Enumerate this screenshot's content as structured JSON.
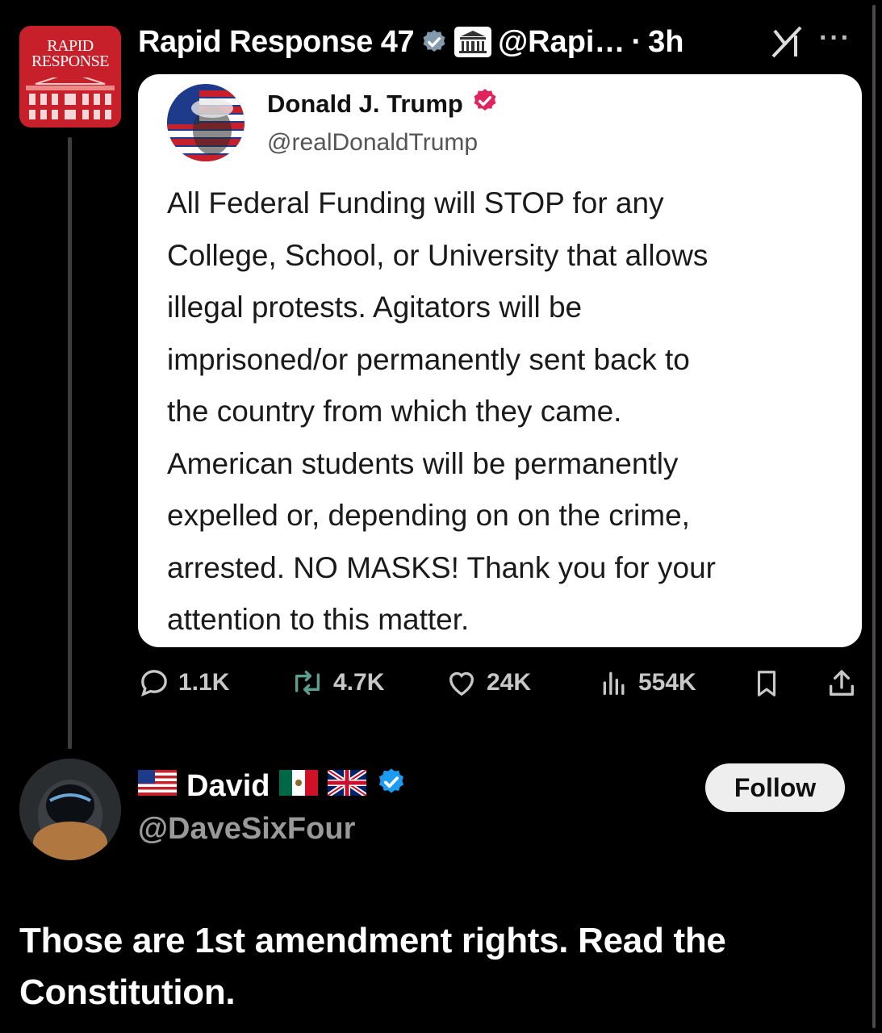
{
  "post": {
    "author_name": "Rapid Response 47",
    "author_handle": "@Rapi…",
    "separator": "·",
    "time": "3h",
    "avatar_text": "RAPID\nRESPONSE"
  },
  "quote": {
    "author_name": "Donald J. Trump",
    "author_handle": "@realDonaldTrump",
    "text": "All Federal Funding will STOP for any\nCollege, School, or University that allows\nillegal protests. Agitators will be\nimprisoned/or permanently sent back to\nthe country from which they came.\nAmerican students will be permanently\nexpelled or, depending on on the crime,\narrested. NO MASKS! Thank you for your\nattention to this matter."
  },
  "actions": {
    "replies": "1.1K",
    "reposts": "4.7K",
    "likes": "24K",
    "views": "554K"
  },
  "reply": {
    "author_name": "David",
    "author_handle": "@DaveSixFour",
    "follow_label": "Follow",
    "text": "Those are 1st amendment rights. Read the Constitution."
  },
  "colors": {
    "background": "#000000",
    "verified_blue": "#1d9bf0",
    "verified_pink": "#e0245e",
    "avatar_red": "#c8202a"
  }
}
